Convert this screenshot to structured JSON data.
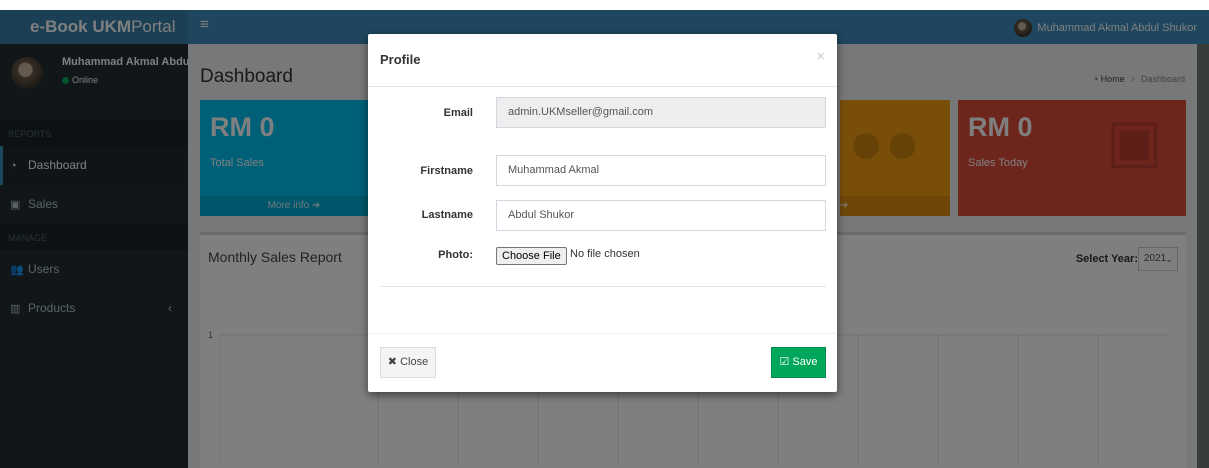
{
  "brand": {
    "name_bold": "e-Book UKM",
    "name_rest": "Portal"
  },
  "topbar": {
    "menu_glyph": "≡",
    "user_name": "Muhammad Akmal Abdul Shukor"
  },
  "sidebar": {
    "user_name": "Muhammad Akmal Abdul Shukor",
    "status": "Online",
    "sections": [
      {
        "header": "REPORTS",
        "items": [
          {
            "label": "Dashboard",
            "icon": "dashboard-icon"
          },
          {
            "label": "Sales",
            "icon": "money-icon"
          }
        ]
      },
      {
        "header": "MANAGE",
        "items": [
          {
            "label": "Users",
            "icon": "users-icon"
          },
          {
            "label": "Products",
            "icon": "barcode-icon"
          }
        ]
      }
    ],
    "products_chevron": "‹"
  },
  "page": {
    "title": "Dashboard",
    "breadcrumb": [
      "Home",
      "Dashboard"
    ]
  },
  "boxes": [
    {
      "value": "RM 0",
      "label": "Total Sales",
      "footer": "More info ➔",
      "color": "#00c0ef"
    },
    {
      "footer": "➔",
      "color": "#f39c12"
    },
    {
      "value": "RM 0",
      "label": "Sales Today",
      "color": "#dd4b39"
    }
  ],
  "report": {
    "title": "Monthly Sales Report",
    "year_label": "Select Year:",
    "year_value": "2021",
    "y_tick": "1"
  },
  "modal": {
    "title": "Profile",
    "close_glyph": "×",
    "email_label": "Email",
    "email_value": "admin.UKMseller@gmail.com",
    "firstname_label": "Firstname",
    "firstname_value": "Muhammad Akmal",
    "lastname_label": "Lastname",
    "lastname_value": "Abdul Shukor",
    "photo_label": "Photo:",
    "file_button": "Choose File",
    "file_status": "No file chosen",
    "close_button": "✖ Close",
    "save_button": "☑ Save",
    "save_color": "#00a65a"
  }
}
